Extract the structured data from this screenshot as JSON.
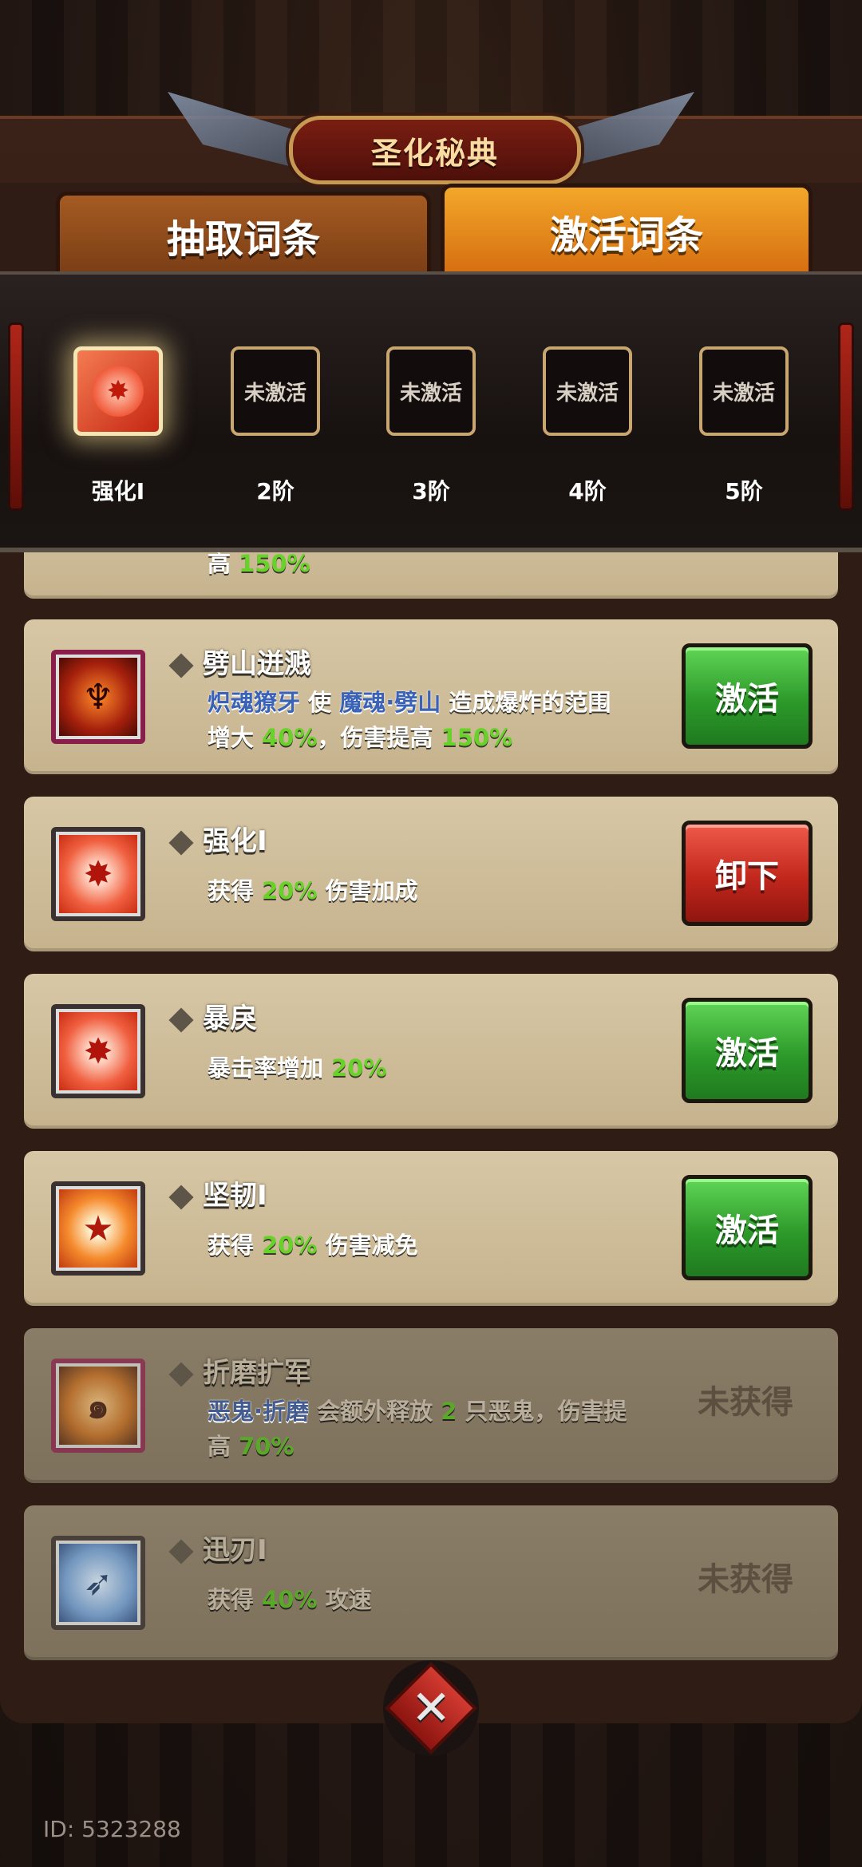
{
  "header": {
    "title": "圣化秘典"
  },
  "tabs": [
    {
      "label": "抽取词条",
      "active": false
    },
    {
      "label": "激活词条",
      "active": true
    }
  ],
  "slots": [
    {
      "label": "强化I",
      "content": "",
      "active": true,
      "icon": "flame-burst-icon"
    },
    {
      "label": "2阶",
      "content": "未激活",
      "active": false
    },
    {
      "label": "3阶",
      "content": "未激活",
      "active": false
    },
    {
      "label": "4阶",
      "content": "未激活",
      "active": false
    },
    {
      "label": "5阶",
      "content": "未激活",
      "active": false
    }
  ],
  "partial_card": {
    "desc_tail_1": "高 ",
    "desc_tail_num": "150%"
  },
  "cards": [
    {
      "title": "劈山迸溅",
      "icon": "demon-horns-icon",
      "desc": {
        "kw1": "炽魂獠牙",
        "t1": " 使 ",
        "kw2": "魔魂·劈山",
        "t2": " 造成爆炸的范围增大 ",
        "n1": "40%",
        "t3": "，伤害提高 ",
        "n2": "150%"
      },
      "action": "激活"
    },
    {
      "title": "强化I",
      "icon": "flame-burst-icon",
      "desc": {
        "t1": "获得 ",
        "n1": "20%",
        "t2": " 伤害加成"
      },
      "action": "卸下"
    },
    {
      "title": "暴戾",
      "icon": "flame-burst-icon",
      "desc": {
        "t1": "暴击率增加 ",
        "n1": "20%"
      },
      "action": "激活"
    },
    {
      "title": "坚韧I",
      "icon": "shield-star-icon",
      "desc": {
        "t1": "获得 ",
        "n1": "20%",
        "t2": " 伤害减免"
      },
      "action": "激活"
    },
    {
      "title": "折磨扩军",
      "icon": "fire-swirl-icon",
      "desc": {
        "kw1": "恶鬼·折磨",
        "t1": " 会额外释放 ",
        "n1": "2",
        "t2": " 只恶鬼，伤害提高 ",
        "n2": "70%"
      },
      "status": "未获得"
    },
    {
      "title": "迅刃I",
      "icon": "blade-speed-icon",
      "desc": {
        "t1": "获得 ",
        "n1": "40%",
        "t2": " 攻速"
      },
      "status": "未获得"
    }
  ],
  "footer": {
    "id": "ID: 5323288"
  },
  "colors": {
    "activate": "#2d9a2a",
    "remove": "#c2271c",
    "keyword": "#3a63b8",
    "number": "#68d12a"
  }
}
